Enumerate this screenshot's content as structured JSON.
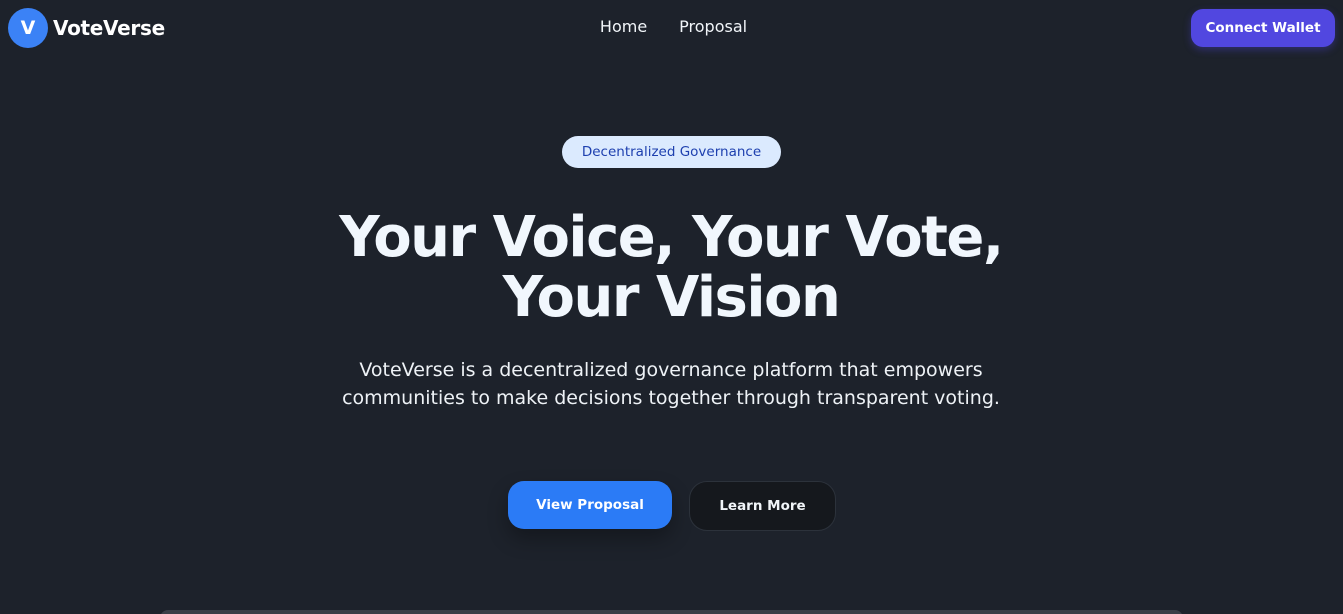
{
  "header": {
    "logo_letter": "V",
    "brand": "VoteVerse",
    "nav": [
      {
        "label": "Home"
      },
      {
        "label": "Proposal"
      }
    ],
    "connect_label": "Connect Wallet"
  },
  "hero": {
    "badge": "Decentralized Governance",
    "title_line1": "Your Voice, Your Vote,",
    "title_line2": "Your Vision",
    "description": "VoteVerse is a decentralized governance platform that empowers communities to make decisions together through transparent voting.",
    "primary_cta": "View Proposal",
    "secondary_cta": "Learn More"
  },
  "colors": {
    "background": "#1d222b",
    "primary_blue": "#2b7bf6",
    "connect_purple": "#5147e0",
    "badge_bg": "#dbeafe",
    "badge_text": "#1e40af"
  }
}
